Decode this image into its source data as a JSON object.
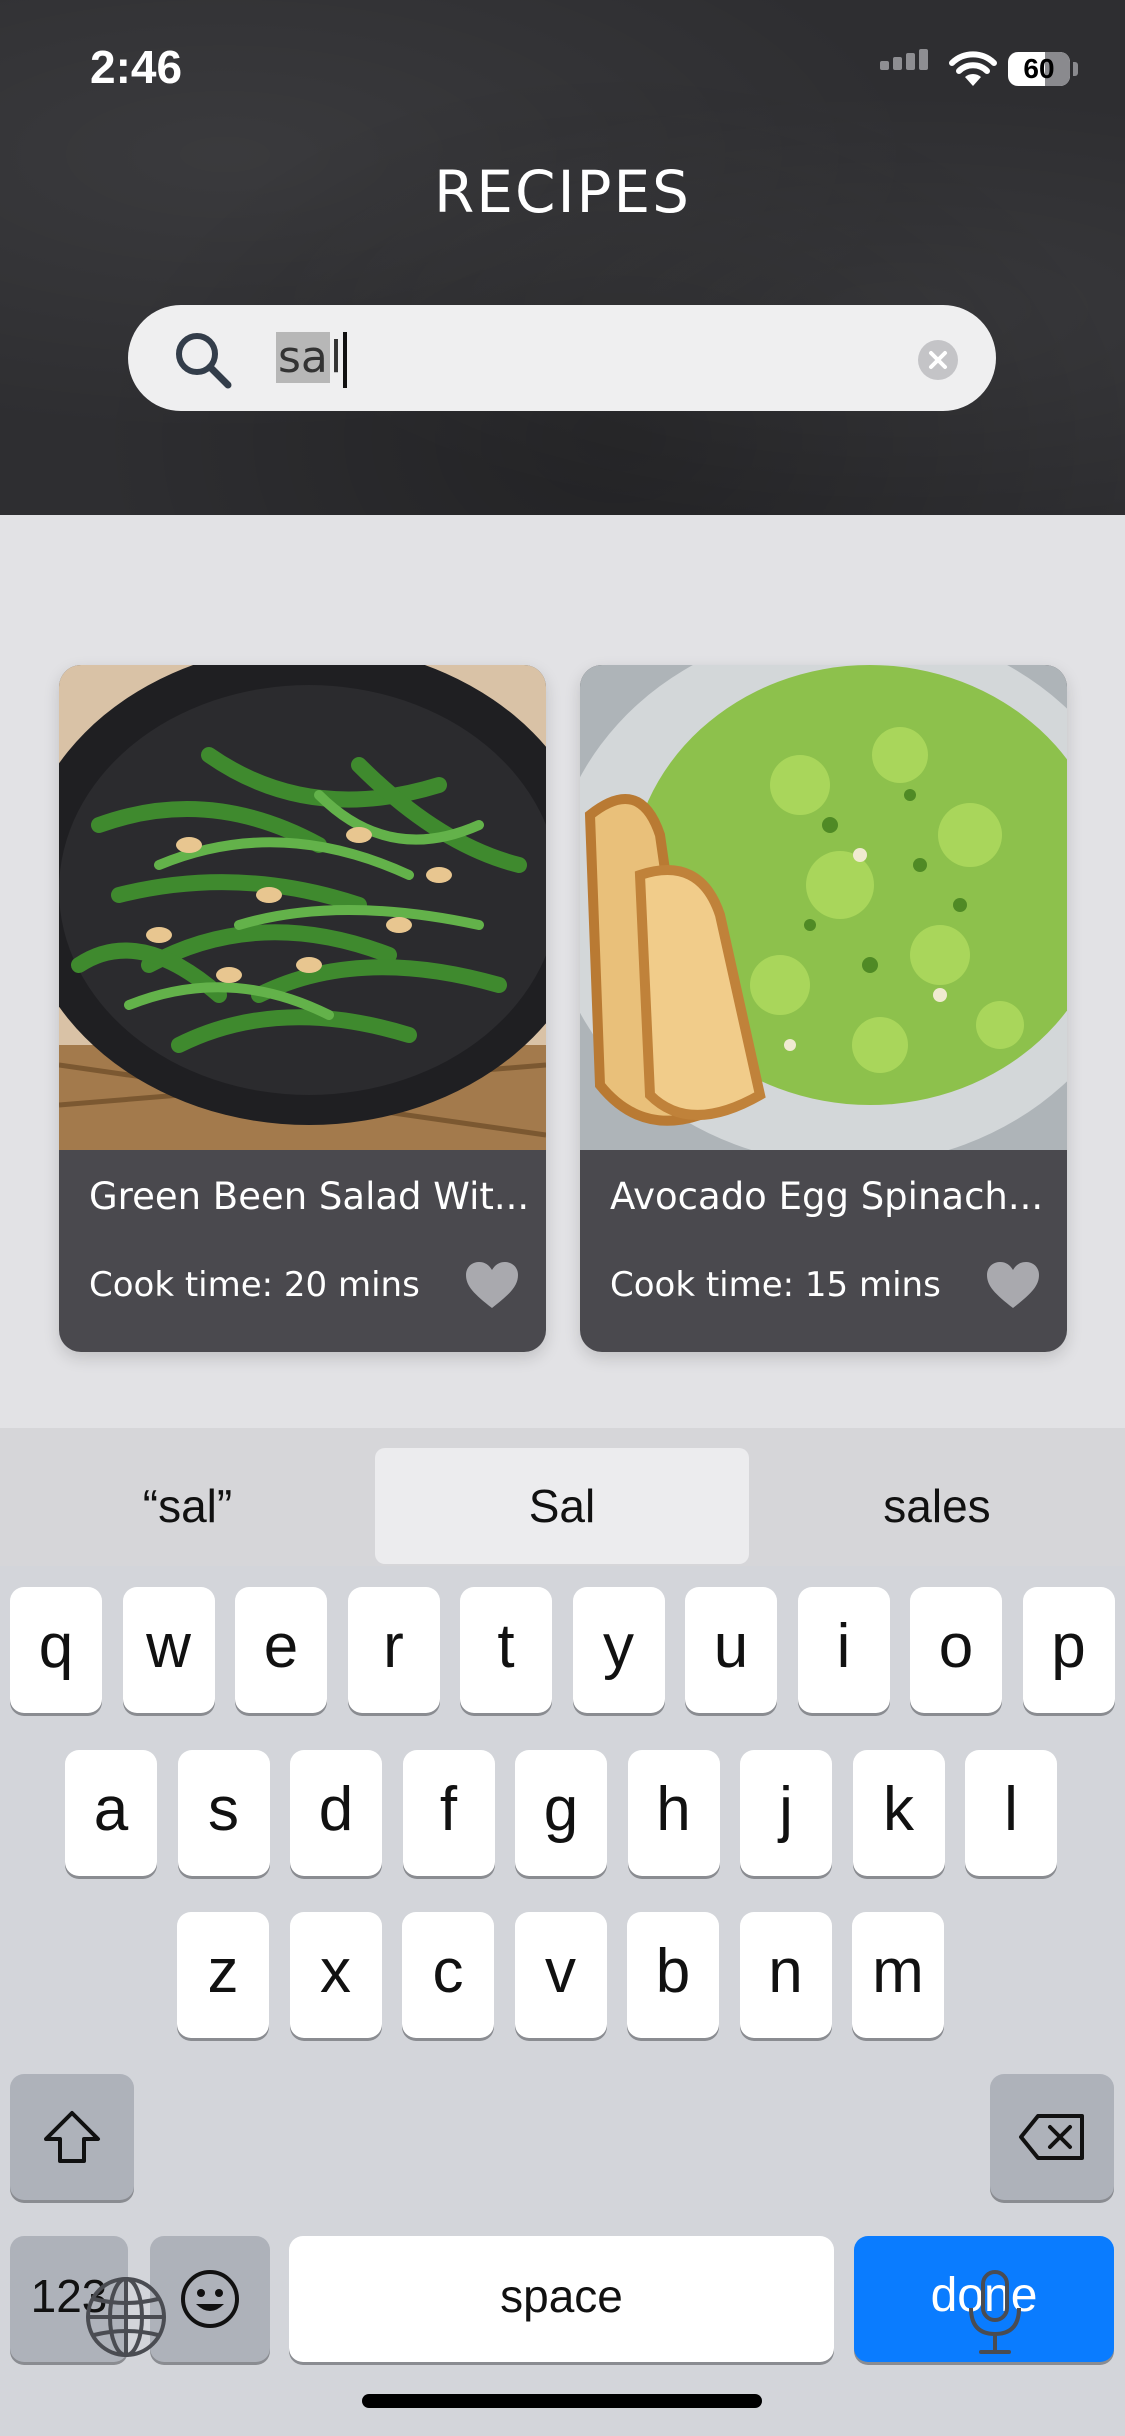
{
  "status_bar": {
    "time": "2:46",
    "battery": "60"
  },
  "header": {
    "title": "RECIPES",
    "background": "#2e2e31"
  },
  "search": {
    "value_selected": "sa",
    "value_rest": "l",
    "icon": "search-icon",
    "clear_icon": "clear-icon"
  },
  "recipes": [
    {
      "title": "Green Been Salad Wit...",
      "cook_time": "Cook time: 20 mins",
      "image": "green-beans-photo",
      "favorite_icon": "heart-icon"
    },
    {
      "title": "Avocado Egg Spinach...",
      "cook_time": "Cook time: 15 mins",
      "image": "avocado-egg-salad-photo",
      "favorite_icon": "heart-icon"
    }
  ],
  "keyboard": {
    "suggestions": [
      "“sal”",
      "Sal",
      "sales"
    ],
    "row1": [
      "q",
      "w",
      "e",
      "r",
      "t",
      "y",
      "u",
      "i",
      "o",
      "p"
    ],
    "row2": [
      "a",
      "s",
      "d",
      "f",
      "g",
      "h",
      "j",
      "k",
      "l"
    ],
    "row3": [
      "z",
      "x",
      "c",
      "v",
      "b",
      "n",
      "m"
    ],
    "numbers_label": "123",
    "space_label": "space",
    "done_label": "done",
    "accent": "#0a7cff"
  }
}
